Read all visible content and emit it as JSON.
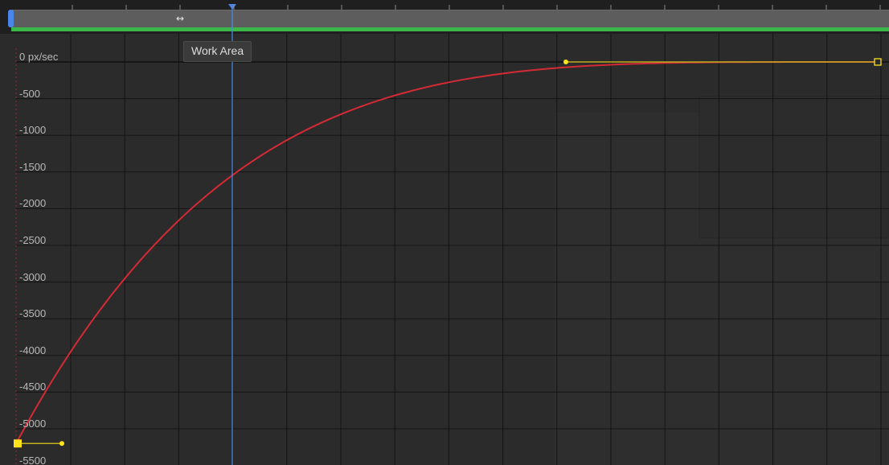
{
  "timeline": {
    "cursor_glyph": "↔",
    "tooltip": "Work Area"
  },
  "graph": {
    "value_labels": [
      "0 px/sec",
      "-500",
      "-1000",
      "-1500",
      "-2000",
      "-2500",
      "-3000",
      "-3500",
      "-4000",
      "-4500",
      "-5000",
      "-5500"
    ],
    "curve": {
      "unit": "px/sec",
      "start_value": -5200,
      "end_value": 0
    },
    "colors": {
      "curve": "#d42a35",
      "playhead": "#4a86e8",
      "work_area": "#3cb84a",
      "keyframe": "#ffe31a",
      "handle": "#c0b020",
      "grid": "#141414"
    }
  }
}
